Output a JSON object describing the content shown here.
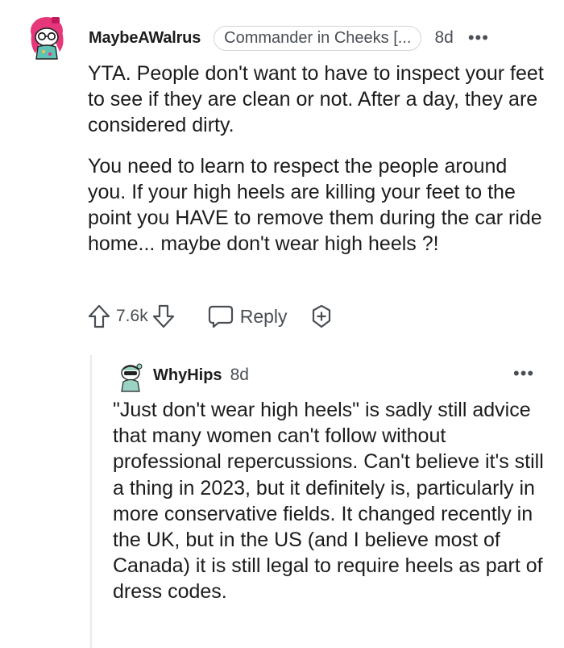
{
  "comment": {
    "username": "MaybeAWalrus",
    "flair": "Commander in Cheeks [...",
    "age": "8d",
    "more_icon": "more-horizontal-icon",
    "paragraphs": [
      "YTA. People don't want to have to inspect your feet to see if they are clean or not. After a day, they are considered dirty.",
      "You need to learn to respect the people around you. If your high heels are killing your feet to the point you HAVE to remove them during the car ride home... maybe don't wear high heels ?!"
    ],
    "vote_count": "7.6k",
    "reply_label": "Reply",
    "icons": {
      "upvote": "arrow-up-icon",
      "downvote": "arrow-down-icon",
      "reply": "speech-bubble-icon",
      "award": "add-award-icon"
    }
  },
  "reply": {
    "username": "WhyHips",
    "age": "8d",
    "more_icon": "more-horizontal-icon",
    "text": "\"Just don't wear high heels\" is sadly still advice that many women can't follow without professional repercussions. Can't believe it's still a thing in 2023, but it definitely is, particularly in more conservative fields. It changed recently in the UK, but in the US (and I believe most of Canada) it is still legal to require heels as part of dress codes."
  },
  "colors": {
    "text": "#1c1c1c",
    "meta": "#4a4f55",
    "flair_border": "#cfd4d9",
    "avatar_pink": "#e5377a",
    "avatar_teal": "#5fc2b4"
  }
}
